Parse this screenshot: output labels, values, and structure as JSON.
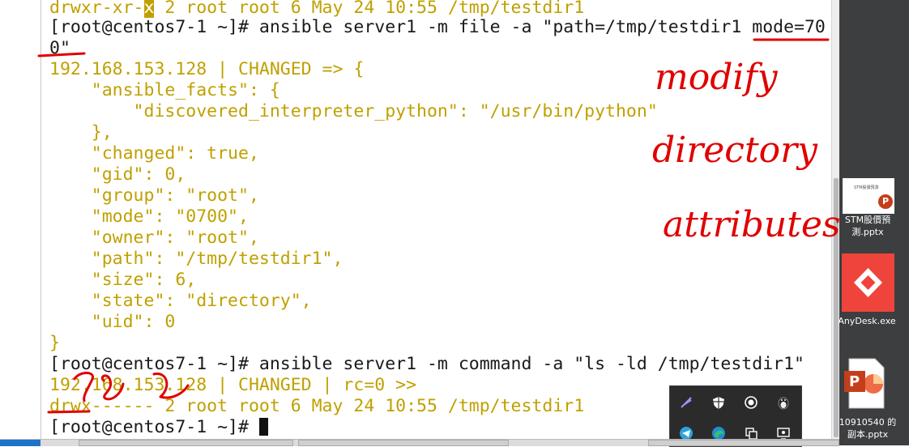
{
  "terminal": {
    "lines": [
      {
        "a": "drwxr-xr-",
        "b": "x",
        "c": " 2 root root 6 May 24 10:55 /tmp/testdir1"
      },
      {
        "text": "[root@centos7-1 ~]# ansible server1 -m file -a \"path=/tmp/testdir1 mode=70"
      },
      {
        "text": "0\""
      },
      {
        "text": "192.168.153.128 | CHANGED => {"
      },
      {
        "text": "    \"ansible_facts\": {"
      },
      {
        "text": "        \"discovered_interpreter_python\": \"/usr/bin/python\""
      },
      {
        "text": "    },"
      },
      {
        "text": "    \"changed\": true,"
      },
      {
        "text": "    \"gid\": 0,"
      },
      {
        "text": "    \"group\": \"root\","
      },
      {
        "text": "    \"mode\": \"0700\","
      },
      {
        "text": "    \"owner\": \"root\","
      },
      {
        "text": "    \"path\": \"/tmp/testdir1\","
      },
      {
        "text": "    \"size\": 6,"
      },
      {
        "text": "    \"state\": \"directory\","
      },
      {
        "text": "    \"uid\": 0"
      },
      {
        "text": "}"
      },
      {
        "text": "[root@centos7-1 ~]# ansible server1 -m command -a \"ls -ld /tmp/testdir1\""
      },
      {
        "text": "192.168.153.128 | CHANGED | rc=0 >>"
      },
      {
        "text": "drwx------ 2 root root 6 May 24 10:55 /tmp/testdir1"
      },
      {
        "text": "[root@centos7-1 ~]# "
      }
    ]
  },
  "annotation": {
    "note_line1": "modify",
    "note_line2": "directory",
    "note_line3": "attributes",
    "scribble": "70",
    "ink_color": "#e00000"
  },
  "desktop": {
    "icons": [
      {
        "name": "STM股價預測.pptx",
        "label1": "STM股價預",
        "label2": "測.pptx",
        "thumb_text": "STM股價預測"
      },
      {
        "name": "AnyDesk.exe",
        "label1": "AnyDesk.exe"
      },
      {
        "name": "10910540的副本.pptx",
        "label1": "10910540 的",
        "label2": "副本.pptx"
      }
    ]
  },
  "colors": {
    "output": "#c0a000",
    "prompt": "#1a1a1a",
    "desktop_bg": "#3c3e40",
    "anydesk": "#ef443b",
    "powerpoint": "#c43e1c"
  }
}
